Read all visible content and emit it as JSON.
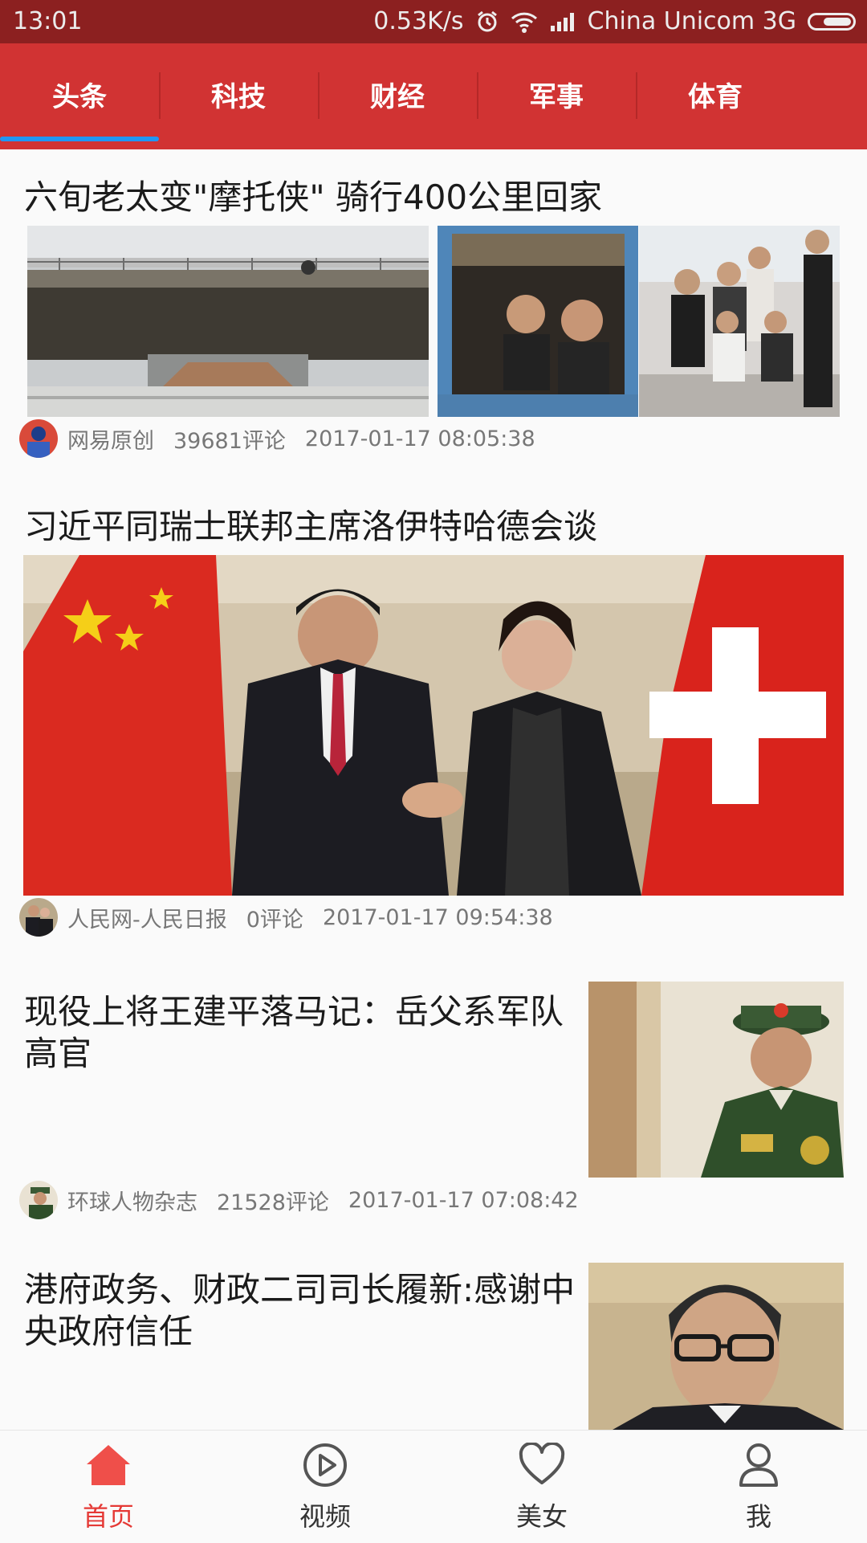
{
  "status": {
    "time": "13:01",
    "speed": "0.53K/s",
    "carrier": "China  Unicom  3G",
    "icons": [
      "alarm-icon",
      "wifi-icon",
      "signal-icon",
      "battery-icon"
    ]
  },
  "tabs": [
    {
      "label": "头条",
      "active": true
    },
    {
      "label": "科技"
    },
    {
      "label": "财经"
    },
    {
      "label": "军事"
    },
    {
      "label": "体育"
    }
  ],
  "articles": [
    {
      "title": "六旬老太变\"摩托侠\" 骑行400公里回家",
      "source": "网易原创",
      "comments": "39681评论",
      "time": "2017-01-17 08:05:38",
      "images": [
        "bridge-photo",
        "children-in-truck-photo",
        "group-of-young-men-photo"
      ]
    },
    {
      "title": "习近平同瑞士联邦主席洛伊特哈德会谈",
      "source": "人民网-人民日报",
      "comments": "0评论",
      "time": "2017-01-17 09:54:38",
      "images": [
        "handshake-with-flags-photo"
      ]
    },
    {
      "title": "现役上将王建平落马记：岳父系军队高官",
      "source": "环球人物杂志",
      "comments": "21528评论",
      "time": "2017-01-17 07:08:42",
      "images": [
        "general-in-uniform-photo"
      ]
    },
    {
      "title": "港府政务、财政二司司长履新:感谢中央政府信任",
      "images": [
        "official-with-glasses-photo"
      ]
    }
  ],
  "bottom_nav": [
    {
      "label": "首页",
      "icon": "home-icon",
      "active": true
    },
    {
      "label": "视频",
      "icon": "play-icon"
    },
    {
      "label": "美女",
      "icon": "heart-icon"
    },
    {
      "label": "我",
      "icon": "user-icon"
    }
  ],
  "colors": {
    "status_bar": "#8c2020",
    "tab_bar": "#d13333",
    "tab_indicator": "#2196f3",
    "active_nav": "#e53935"
  }
}
